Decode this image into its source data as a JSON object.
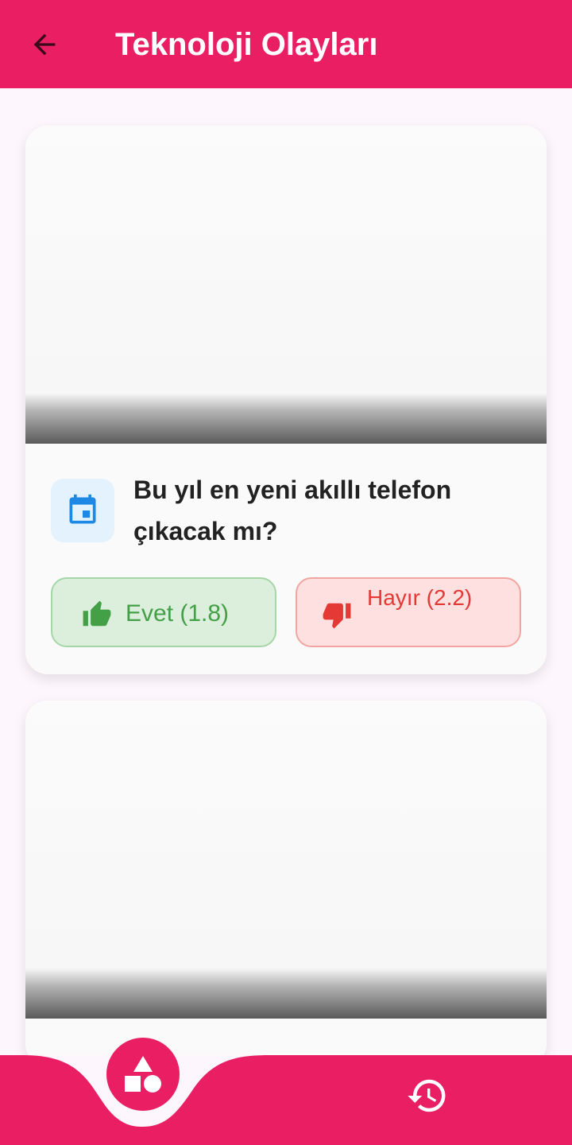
{
  "appbar": {
    "title": "Teknoloji Olayları",
    "back_icon": "arrow-back-icon",
    "color": "#e91e63"
  },
  "cards": [
    {
      "icon": "calendar-icon",
      "question": "Bu yıl en yeni akıllı telefon çıkacak mı?",
      "yes_label": "Evet (1.8)",
      "no_label": "Hayır (2.2)",
      "yes_icon": "thumb-up-icon",
      "no_icon": "thumb-down-icon"
    },
    {
      "icon": "",
      "question": ""
    }
  ],
  "colors": {
    "yes": "#43a047",
    "no": "#e53935",
    "calendar": "#1e88e5"
  },
  "bottom_nav": {
    "items": [
      {
        "icon": "categories-icon",
        "active": true
      },
      {
        "icon": "history-icon",
        "active": false
      }
    ]
  }
}
